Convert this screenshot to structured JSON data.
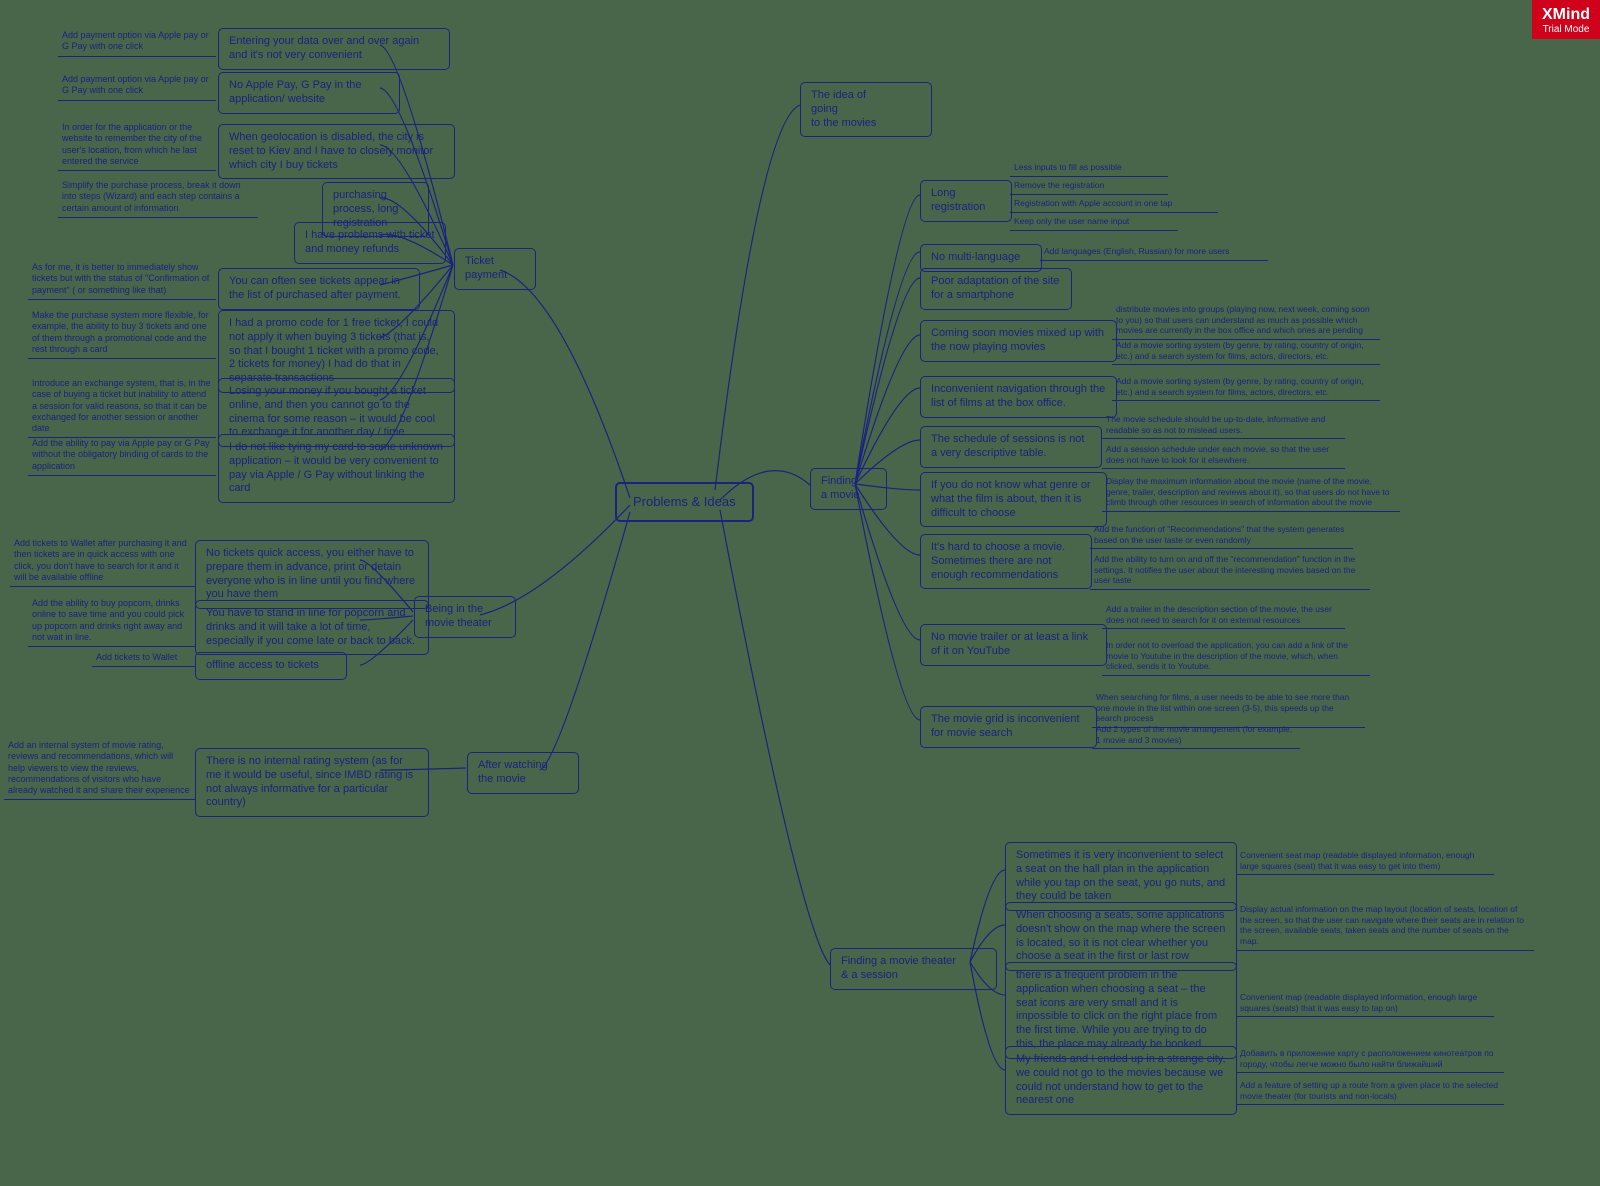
{
  "watermark": {
    "big": "XMind",
    "small": "Trial Mode"
  },
  "central": "Problems & Ideas",
  "branches": {
    "idea": "The idea of\ngoing\nto the movies",
    "ticket": "Ticket\npayment",
    "being": "Being in the\nmovie theater",
    "after": "After watching\nthe movie",
    "finding_movie": "Finding\na movie",
    "finding_theater": "Finding a movie theater\n& a session"
  },
  "ticket_children": [
    "Entering your data over and over again and it's not very convenient",
    "No Apple Pay, G Pay in the application/ website",
    "When geolocation is disabled, the city is reset to Kiev and I have to closely monitor which city I buy tickets",
    "purchasing process, long registration",
    "I have problems with ticket and money refunds",
    "You can often see tickets appear in the list of purchased after payment.",
    "I had a promo code for 1 free ticket, I could not apply it when buying 3 tickets (that is, so that I bought 1 ticket with a promo code, 2 tickets for money) I had do that in separate transactions",
    "Losing your money if you bought a ticket online, and then you cannot go to the cinema for some reason – it would be cool to exchange it for another day / time",
    "I do not like tying my card to some unknown application – it would be very convenient to pay via Apple / G Pay without linking the card"
  ],
  "ticket_leaves": [
    "Add payment option via Apple pay or G Pay with one click",
    "Add payment option via Apple pay or G Pay with one click",
    "In order for the application or the website to remember the city of the user's location, from which he last entered the service",
    "Simplify the purchase process, break it down into steps (Wizard) and each step contains a certain amount of information",
    "As for me, it is better to immediately show tickets but with the status of \"Confirmation of payment\" ( or something like that)",
    "Make the purchase system more flexible, for example, the ability to buy 3 tickets and one of them through a promotional code and the rest through a card",
    "Introduce an exchange system, that is, in the case of buying a ticket but inability to attend a session for valid reasons, so that it can be exchanged for another session or another date",
    "Add the ability to pay via Apple pay or G Pay without the obligatory binding of cards to the application"
  ],
  "being_children": [
    "No tickets quick access, you either have to prepare them in advance, print or detain everyone who is in line until you find where you have them",
    "You have to stand in line for popcorn and drinks and it will take a lot of time, especially if you come late or back to back.",
    "offline access to tickets"
  ],
  "being_leaves": [
    "Add tickets to Wallet after purchasing it and then tickets are in quick access with one click, you don't have to search for it and it will be available offline",
    "Add the ability to buy popcorn, drinks online to save time and you could pick up popcorn and drinks right away and not wait in line.",
    "Add tickets to Wallet"
  ],
  "after_children": [
    "There is no internal rating system (as for me it would be useful, since IMBD rating is not always informative for a particular country)"
  ],
  "after_leaves": [
    "Add an internal system of movie rating, reviews and recommendations, which will help viewers to view the reviews, recommendations of visitors who have already watched it and share their experience"
  ],
  "finding_movie_children": [
    "Long\nregistration",
    "No multi-language",
    "Poor adaptation of the site for a smartphone",
    "Coming soon movies mixed up with the now playing movies",
    "Inconvenient navigation through the list of films at the box office.",
    "The schedule of sessions is not a very descriptive table.",
    "If you do not know what genre or what the film is about, then it is difficult to choose",
    "It's hard to choose a movie. Sometimes there are not enough recommendations",
    "No movie trailer or at least a link of it on YouTube",
    "The movie grid is inconvenient for movie search"
  ],
  "finding_movie_leaves": {
    "reg": [
      "Less inputs to fill as possible",
      "Remove the registration",
      "Registration with Apple account in one tap",
      "Keep only the user name input"
    ],
    "multi": "Add languages (English, Russian) for more users",
    "coming": [
      "distribute movies into groups (playing now, next week, coming soon to you) so that users can understand as much as possible which movies are currently in the box office and which ones are pending",
      "Add a movie sorting system (by genre, by rating, country of origin, etc.) and a search system for films, actors, directors, etc."
    ],
    "nav": "Add a movie sorting system (by genre, by rating, country of origin, etc.) and a search system for films, actors, directors, etc.",
    "schedule": [
      "The movie schedule should be up-to-date, informative and readable so as not to mislead users.",
      "Add a session schedule under each movie, so that the user does not have to look for it elsewhere."
    ],
    "genre": "Display the maximum information about the movie (name of the movie, genre, trailer, description and reviews about it), so that users do not have to climb through other resources in search of information about the movie",
    "recs": [
      "Add the function of \"Recommendations\" that the system generates based on the user taste or even randomly",
      "Add the ability to turn on and off the \"recommendation\" function in the settings. It notifies the user about the interesting movies based on the user taste"
    ],
    "trailer": [
      "Add a trailer in the description section of the movie, the user does not need to search for it on external resources",
      "In order not to overload the application, you can add a link of the movie to Youtube in the description of the movie, which, when clicked, sends it to Youtube."
    ],
    "grid": [
      "When searching for films, a user needs to be able to see more than one movie in the list within one screen (3-5), this speeds up the search process",
      "Add 2 types of the movie arrangement (for example, 1 movie and 3 movies)"
    ]
  },
  "finding_theater_children": [
    "Sometimes it is very inconvenient to select a seat on the hall plan in the application while you tap on the seat, you go nuts, and they could be taken",
    "When choosing a seats, some applications doesn't show on the map where the screen is located, so it is not clear whether you choose a seat in the first or last row",
    "there is a frequent problem in the application when choosing a seat – the seat icons are very small and it is impossible to click on the right place from the first time. While you are trying to do this, the place may already be booked.",
    "My friends and I ended up in a strange city, we could not go to the movies because we could not understand how to get to the nearest one"
  ],
  "finding_theater_leaves": [
    "Convenient seat map (readable displayed information, enough large squares (seat) that it was easy to get into them)",
    "Display actual information on the map layout (location of seats, location of the screen, so that the user can navigate where their seats are in relation to the screen, available seats, taken seats and the number of seats on the map.",
    "Convenient map (readable displayed information, enough large squares (seats) that it was easy to tap on)",
    "Добавить в приложение карту с расположением кинотеатров по городу, чтобы легче можно было найти ближайший",
    "Add a feature of setting up a route from a given place to the selected movie theater (for tourists and non-locals)"
  ]
}
